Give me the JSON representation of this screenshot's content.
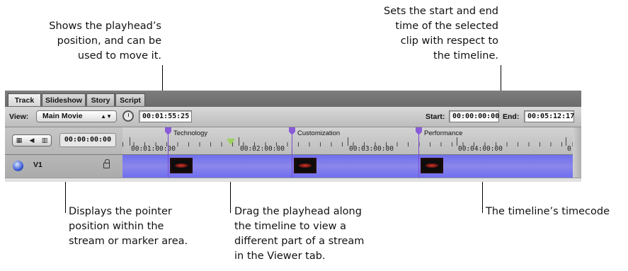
{
  "callouts": {
    "playhead_position": "Shows the playhead’s\nposition, and can be\nused to move it.",
    "start_end": "Sets the start and end\ntime of the selected\nclip with respect to\nthe timeline.",
    "pointer_position": "Displays the pointer\nposition within the\nstream or marker area.",
    "drag_playhead": "Drag the playhead along\nthe timeline to view a\ndifferent part of a stream\nin the Viewer tab.",
    "timecode": "The timeline’s timecode"
  },
  "tabs": [
    "Track",
    "Slideshow",
    "Story",
    "Script"
  ],
  "toolbar": {
    "view_label": "View:",
    "view_value": "Main Movie",
    "playhead_time": "00:01:55:25",
    "start_label": "Start:",
    "start_value": "00:00:00:00",
    "end_label": "End:",
    "end_value": "00:05:12:17"
  },
  "left_panel": {
    "segment_icons": [
      "▦",
      "◀",
      "▥"
    ],
    "pointer_time": "00:00:00:00",
    "track_name": "V1"
  },
  "markers": [
    "Technology",
    "Customization",
    "Performance"
  ],
  "timecodes": [
    "00:01:00:00",
    "00:02:00:00",
    "00:03:00:00",
    "00:04:00:00",
    "0"
  ],
  "icons": {
    "clock": "clock-icon",
    "lock": "lock-icon",
    "track": "video-track-icon",
    "marker": "chapter-marker-icon",
    "playhead": "playhead-icon"
  },
  "colors": {
    "stream": "#7c79ee",
    "marker": "#8a5bd8",
    "playhead": "#9bd35c"
  }
}
